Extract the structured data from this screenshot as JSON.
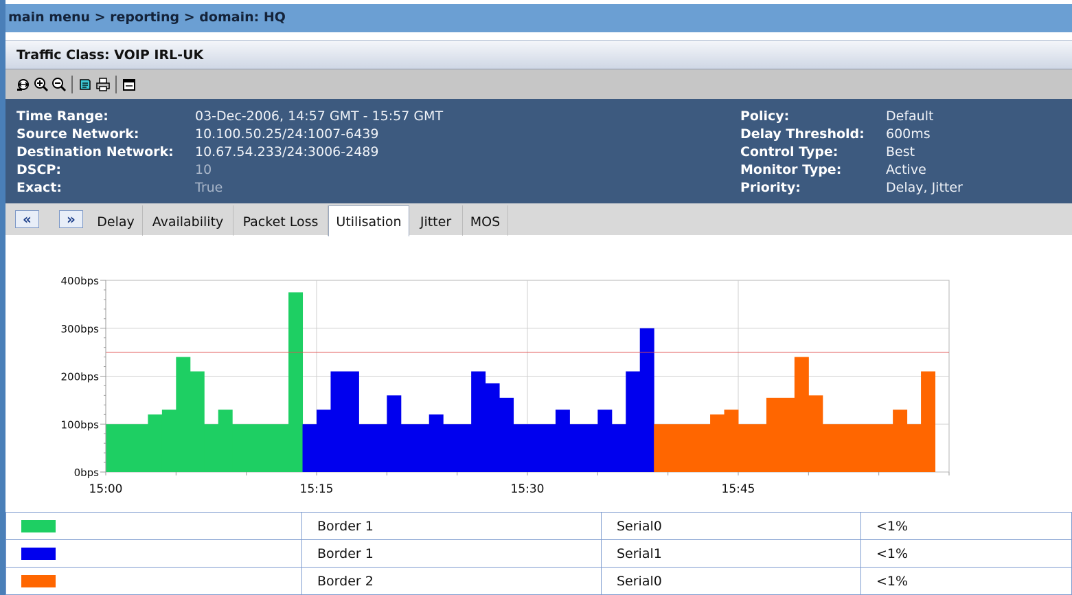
{
  "breadcrumb": "main menu > reporting > domain: HQ",
  "traffic_class": "Traffic Class: VOIP IRL-UK",
  "toolbar": {
    "icons": [
      "fit-zoom-icon",
      "zoom-in-icon",
      "zoom-out-icon",
      "edit-report-icon",
      "print-icon",
      "window-icon"
    ]
  },
  "info": {
    "left": [
      {
        "label": "Time Range:",
        "value": "03-Dec-2006, 14:57 GMT - 15:57 GMT"
      },
      {
        "label": "Source Network:",
        "value": "10.100.50.25/24:1007-6439"
      },
      {
        "label": "Destination Network:",
        "value": "10.67.54.233/24:3006-2489"
      },
      {
        "label": "DSCP:",
        "value": "10"
      },
      {
        "label": "Exact:",
        "value": "True"
      }
    ],
    "right": [
      {
        "label": "Policy:",
        "value": "Default"
      },
      {
        "label": "Delay Threshold:",
        "value": "600ms"
      },
      {
        "label": "Control Type:",
        "value": "Best"
      },
      {
        "label": "Monitor Type:",
        "value": "Active"
      },
      {
        "label": "Priority:",
        "value": "Delay, Jitter"
      }
    ]
  },
  "tabs": {
    "prev_label": "«",
    "next_label": "»",
    "items": [
      "Delay",
      "Availability",
      "Packet Loss",
      "Utilisation",
      "Jitter",
      "MOS"
    ],
    "active": "Utilisation"
  },
  "chart_data": {
    "type": "area",
    "y_tick_labels": [
      "0bps",
      "100bps",
      "200bps",
      "300bps",
      "400bps"
    ],
    "x_tick_labels": [
      "15:00",
      "15:15",
      "15:30",
      "15:45"
    ],
    "ylim": [
      0,
      400
    ],
    "xlim_minutes": [
      0,
      60
    ],
    "grid": true,
    "threshold_bps": 250,
    "threshold_color": "#e05050",
    "series": [
      {
        "color": "#1ecf63",
        "steps": [
          [
            0,
            100
          ],
          [
            3,
            120
          ],
          [
            4,
            130
          ],
          [
            5,
            240
          ],
          [
            6,
            210
          ],
          [
            7,
            100
          ],
          [
            8,
            130
          ],
          [
            9,
            100
          ],
          [
            13,
            375
          ]
        ],
        "end": 14
      },
      {
        "color": "#0000ee",
        "steps": [
          [
            14,
            100
          ],
          [
            15,
            130
          ],
          [
            16,
            210
          ],
          [
            18,
            100
          ],
          [
            20,
            160
          ],
          [
            21,
            100
          ],
          [
            23,
            120
          ],
          [
            24,
            100
          ],
          [
            26,
            210
          ],
          [
            27,
            185
          ],
          [
            28,
            155
          ],
          [
            29,
            100
          ],
          [
            32,
            130
          ],
          [
            33,
            100
          ],
          [
            35,
            130
          ],
          [
            36,
            100
          ],
          [
            37,
            210
          ],
          [
            38,
            300
          ]
        ],
        "end": 39
      },
      {
        "color": "#ff6600",
        "steps": [
          [
            39,
            100
          ],
          [
            43,
            120
          ],
          [
            44,
            130
          ],
          [
            45,
            100
          ],
          [
            47,
            155
          ],
          [
            49,
            240
          ],
          [
            50,
            160
          ],
          [
            51,
            100
          ],
          [
            56,
            130
          ],
          [
            57,
            100
          ],
          [
            58,
            210
          ]
        ],
        "end": 59
      }
    ]
  },
  "legend": [
    {
      "color": "#1ecf63",
      "border": "Border 1",
      "interface": "Serial0",
      "util": "<1%"
    },
    {
      "color": "#0000ee",
      "border": "Border 1",
      "interface": "Serial1",
      "util": "<1%"
    },
    {
      "color": "#ff6600",
      "border": "Border 2",
      "interface": "Serial0",
      "util": "<1%"
    }
  ]
}
